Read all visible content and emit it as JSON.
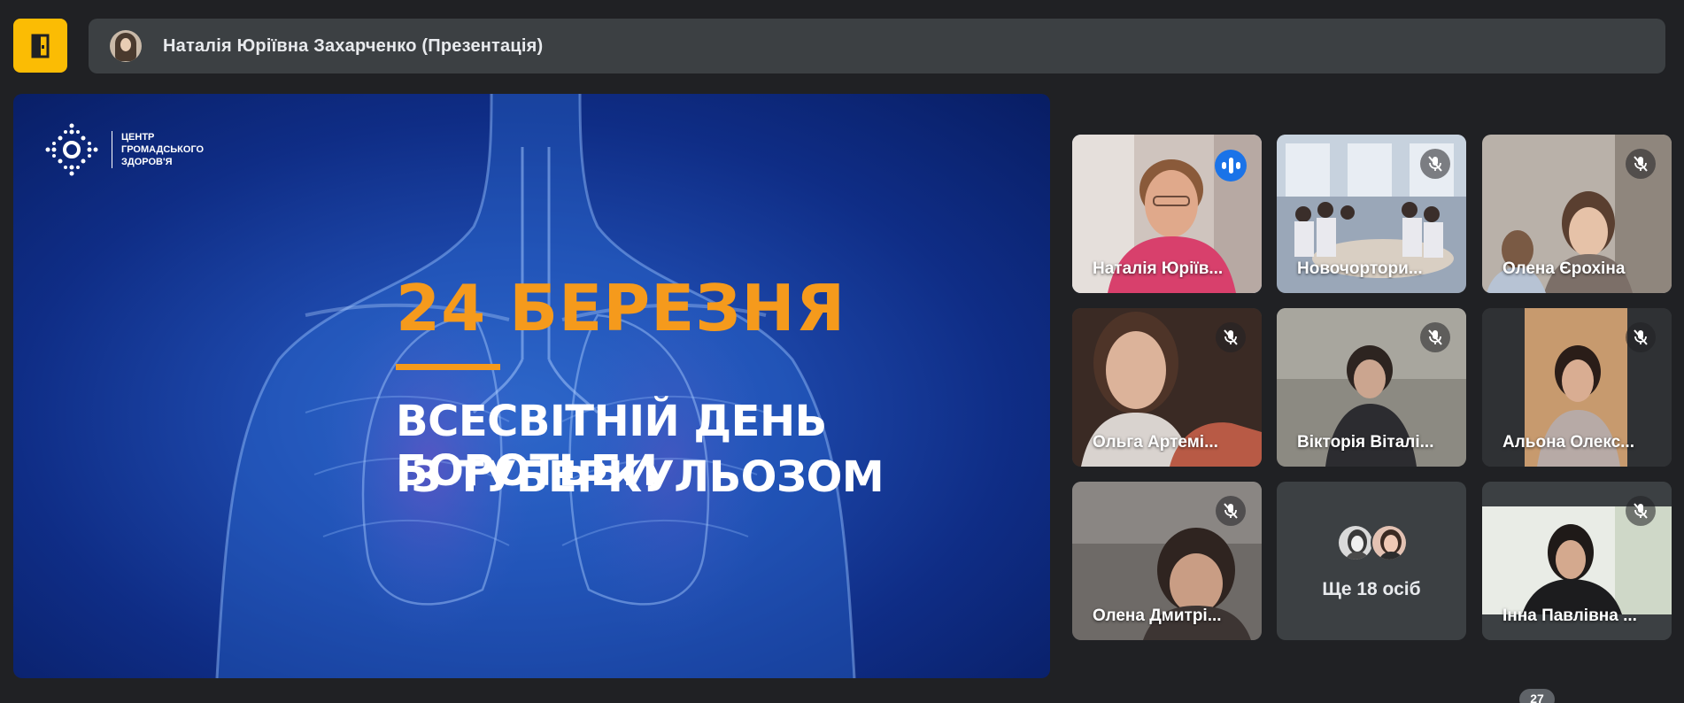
{
  "presenter": {
    "name": "Наталія Юріївна Захарченко (Презентація)",
    "avatar_icon": "avatar-photo"
  },
  "leave_button": {
    "icon": "door-exit-icon",
    "color": "#fbbc04"
  },
  "slide": {
    "logo_text": "ЦЕНТР\nГРОМАДСЬКОГО\nЗДОРОВ'Я",
    "date": "24 БЕРЕЗНЯ",
    "line1": "ВСЕСВІТНІЙ ДЕНЬ БОРОТЬБИ",
    "line2": "ІЗ ТУБЕРКУЛЬОЗОМ",
    "accent_color": "#f59a1c"
  },
  "participants": [
    {
      "name": "Наталія Юріїв...",
      "status": "speaking"
    },
    {
      "name": "Новочортори...",
      "status": "muted"
    },
    {
      "name": "Олена Єрохіна",
      "status": "muted"
    },
    {
      "name": "Ольга Артемі...",
      "status": "muted"
    },
    {
      "name": "Вікторія Віталі...",
      "status": "muted"
    },
    {
      "name": "Альона Олекс...",
      "status": "muted"
    },
    {
      "name": "Олена Дмитрі...",
      "status": "muted"
    },
    {
      "name": "Інна Павлівна ...",
      "status": "muted"
    }
  ],
  "more_tile": {
    "label": "Ще 18 осіб"
  },
  "participant_count": "27",
  "colors": {
    "background": "#202124",
    "tile": "#3c4043",
    "active_outline": "#8ab4f8",
    "speaking": "#1a73e8"
  }
}
